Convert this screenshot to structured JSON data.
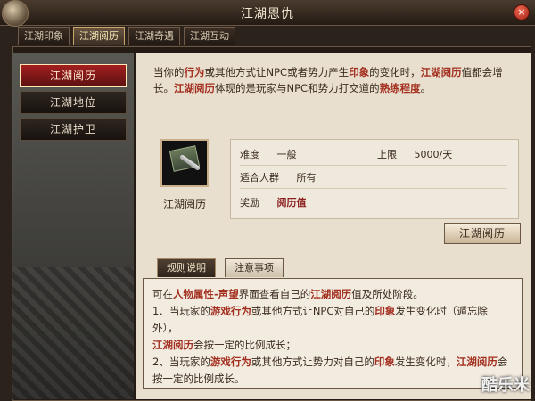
{
  "window": {
    "title": "江湖恩仇"
  },
  "tabs": [
    "江湖印象",
    "江湖阅历",
    "江湖奇遇",
    "江湖互动"
  ],
  "left_nav": [
    "江湖阅历",
    "江湖地位",
    "江湖护卫"
  ],
  "intro": {
    "p1": "当你的",
    "b1": "行为",
    "p2": "或其他方式让NPC或者势力产生",
    "b2": "印象",
    "p3": "的变化时，",
    "b3": "江湖阅历",
    "p4": "值都会增长。",
    "b4": "江湖阅历",
    "p5": "体现的是玩家与NPC和势力打交道的",
    "b5": "熟练程度",
    "p6": "。"
  },
  "item": {
    "label": "江湖阅历"
  },
  "info": {
    "difficulty_label": "难度",
    "difficulty_value": "一般",
    "limit_label": "上限",
    "limit_value": "5000/天",
    "audience_label": "适合人群",
    "audience_value": "所有",
    "reward_label": "奖励",
    "reward_value": "阅历值"
  },
  "action_button": "江湖阅历",
  "subtabs": [
    "规则说明",
    "注意事项"
  ],
  "rules": {
    "line1_a": "可在",
    "line1_b": "人物属性-声望",
    "line1_c": "界面查看自己的",
    "line1_d": "江湖阅历",
    "line1_e": "值及所处阶段。",
    "line2_a": "1、当玩家的",
    "line2_b": "游戏行为",
    "line2_c": "或其他方式让NPC对自己的",
    "line2_d": "印象",
    "line2_e": "发生变化时（遁忘除外），",
    "line3_a": "江湖阅历",
    "line3_b": "会按一定的比例成长；",
    "line4_a": "2、当玩家的",
    "line4_b": "游戏行为",
    "line4_c": "或其他方式让势力对自己的",
    "line4_d": "印象",
    "line4_e": "发生变化时，",
    "line4_f": "江湖阅历",
    "line4_g": "会按一定的比例成长。"
  },
  "watermark": "酷乐米"
}
